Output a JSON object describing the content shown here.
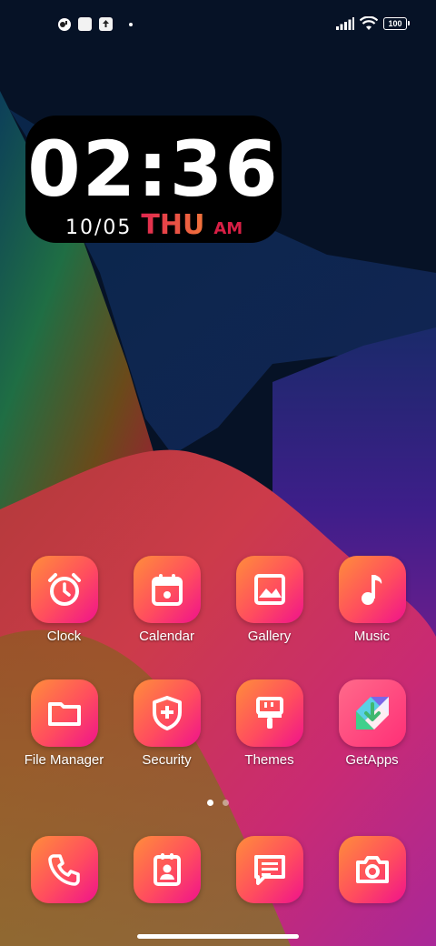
{
  "status_bar": {
    "left_icons": [
      "app-notification-icon",
      "square-notification-icon",
      "upload-notification-icon",
      "dot-icon"
    ],
    "right_icons": [
      "signal-icon",
      "wifi-icon",
      "battery-icon"
    ],
    "battery_level": "100"
  },
  "clock_widget": {
    "time": "02:36",
    "date": "10/05",
    "weekday": "THU",
    "ampm": "AM"
  },
  "apps": [
    {
      "label": "Clock",
      "icon": "alarm-clock-icon"
    },
    {
      "label": "Calendar",
      "icon": "calendar-icon"
    },
    {
      "label": "Gallery",
      "icon": "image-icon"
    },
    {
      "label": "Music",
      "icon": "music-note-icon"
    },
    {
      "label": "File Manager",
      "icon": "folder-icon"
    },
    {
      "label": "Security",
      "icon": "shield-plus-icon"
    },
    {
      "label": "Themes",
      "icon": "paintbrush-icon"
    },
    {
      "label": "GetApps",
      "icon": "getapps-download-icon"
    }
  ],
  "pages": {
    "count": 2,
    "active": 1
  },
  "dock": [
    {
      "icon": "phone-icon"
    },
    {
      "icon": "contacts-icon"
    },
    {
      "icon": "messages-icon"
    },
    {
      "icon": "camera-icon"
    }
  ],
  "colors": {
    "icon_gradient_start": "#ff8d3b",
    "icon_gradient_end": "#f0128c",
    "accent_red": "#d81f45"
  }
}
